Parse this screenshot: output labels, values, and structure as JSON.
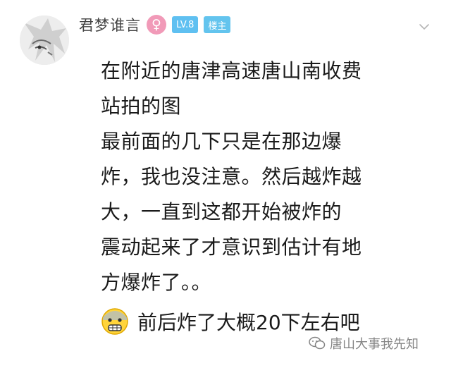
{
  "post": {
    "username": "君梦谁言",
    "gender_icon": "female-icon",
    "level_badge": "LV.8",
    "op_badge": "楼主",
    "lines": [
      "在附近的唐津高速唐山南收费",
      "站拍的图",
      "最前面的几下只是在那边爆",
      "炸，我也没注意。然后越炸越",
      "大，一直到这都开始被炸的",
      "震动起来了才意识到估计有地",
      "方爆炸了。。"
    ],
    "last_line": "前后炸了大概20下左右吧",
    "emoji_icon": "fearful-face-icon"
  },
  "watermark": {
    "icon": "wechat-icon",
    "text": "唐山大事我先知"
  },
  "colors": {
    "gender_pink": "#f19ab8",
    "badge_blue": "#5fc0f1"
  }
}
